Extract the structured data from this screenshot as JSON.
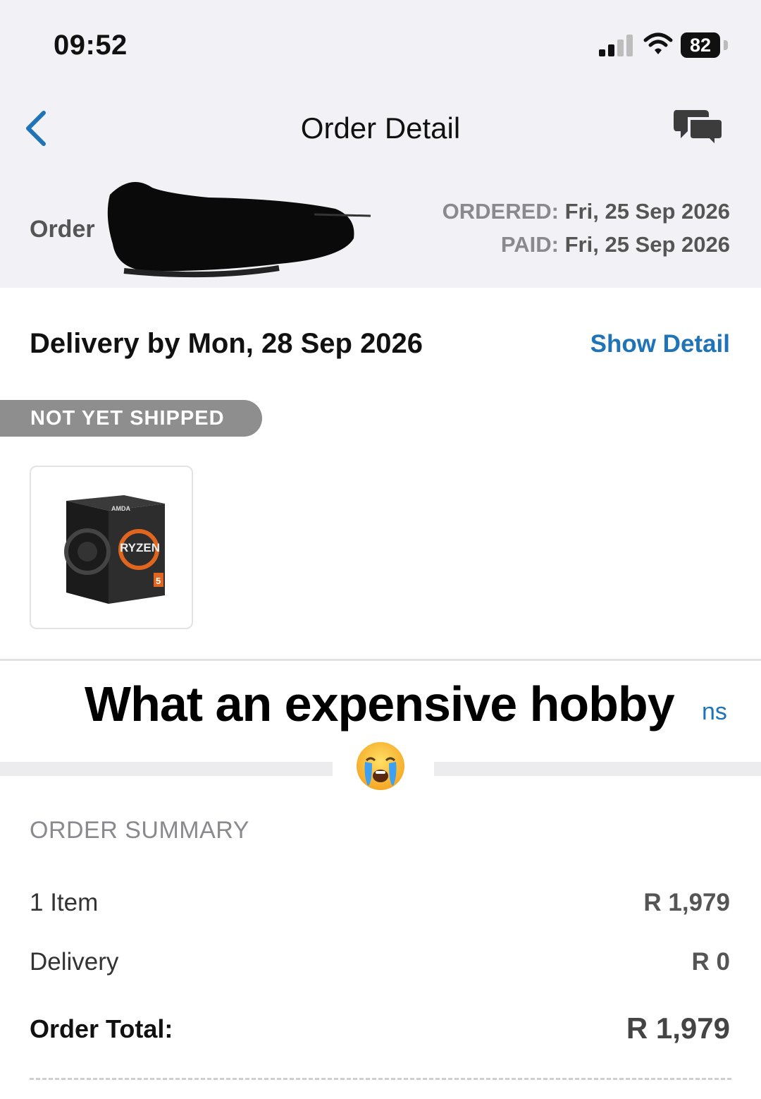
{
  "status_bar": {
    "time": "09:52",
    "battery": "82"
  },
  "nav": {
    "title": "Order Detail",
    "back_icon": "chevron-left-icon",
    "chat_icon": "chat-bubbles-icon"
  },
  "order": {
    "label": "Order",
    "ordered_label": "ORDERED:",
    "ordered_date": "Fri, 25 Sep 2026",
    "paid_label": "PAID:",
    "paid_date": "Fri, 25 Sep 2026"
  },
  "delivery": {
    "text": "Delivery by Mon, 28 Sep 2026",
    "show_detail": "Show Detail"
  },
  "shipment": {
    "status": "NOT YET SHIPPED"
  },
  "product": {
    "brand": "AMDA",
    "name": "RYZEN",
    "model": "5"
  },
  "overlay": {
    "caption": "What an expensive hobby",
    "fragment": "ns",
    "emoji": "loudly-crying-face"
  },
  "summary": {
    "heading": "ORDER SUMMARY",
    "rows": [
      {
        "label": "1 Item",
        "value": "R 1,979"
      },
      {
        "label": "Delivery",
        "value": "R 0"
      }
    ],
    "total_label": "Order Total:",
    "total_value": "R 1,979"
  },
  "colors": {
    "accent": "#1f74b8",
    "header_bg": "#f2f2f6",
    "badge_bg": "#8e8e8e"
  }
}
